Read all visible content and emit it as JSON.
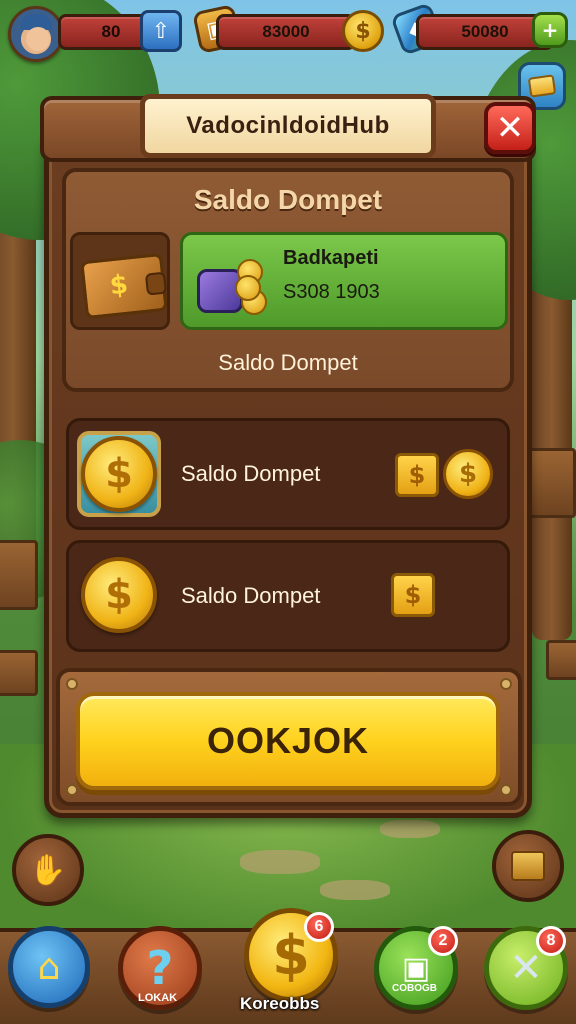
{
  "hud": {
    "level_value": "80",
    "gold_value": "83000",
    "gems_value": "50080",
    "plus_label": "+"
  },
  "dialog": {
    "title": "Vadocinldoid­Hub",
    "close_label": "✕",
    "wallet_heading": "Saldo Dompet",
    "balance_label": "Badkapeti",
    "balance_amount": "S308 1903",
    "wallet_subtitle": "Saldo Dompet",
    "rows": [
      {
        "label": "Saldo Dompet"
      },
      {
        "label": "Saldo Dompet"
      }
    ],
    "confirm_label": "OOKJOK"
  },
  "bottom_nav": {
    "help_label": "LOKAK",
    "coins_label": "Koreobbs",
    "shop_label": "COBOGB",
    "coins_badge": "6",
    "shop_badge": "2",
    "battle_badge": "8"
  },
  "icons": {
    "coin_symbol": "$",
    "help_symbol": "?",
    "battle_symbol": "✕"
  },
  "colors": {
    "panel_brown": "#5a321a",
    "confirm_yellow": "#ffd21e",
    "balance_green": "#6bbf3f",
    "close_red": "#d8322a"
  }
}
